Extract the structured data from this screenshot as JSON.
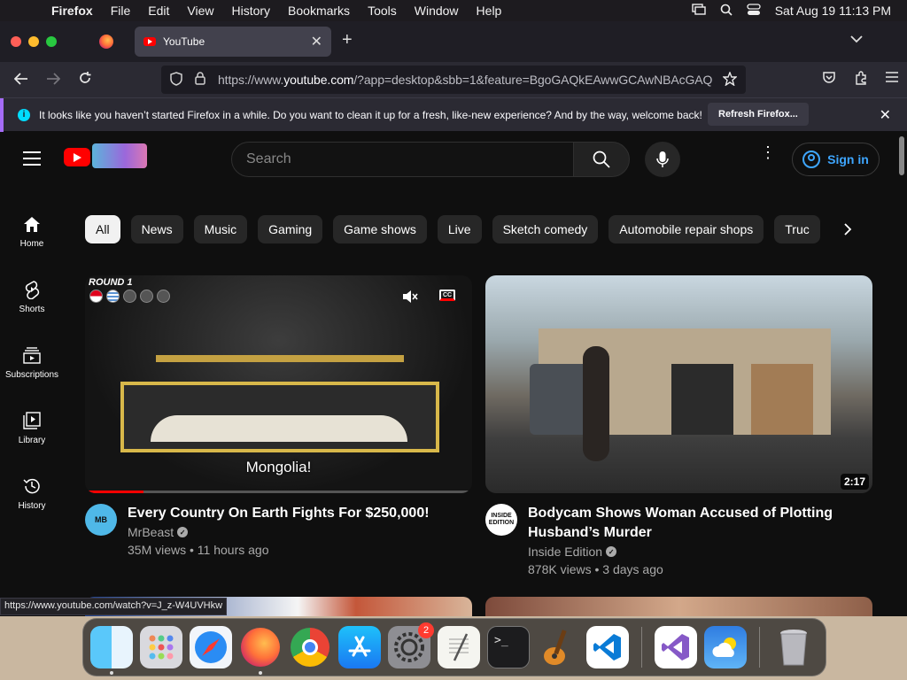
{
  "menubar": {
    "app_name": "Firefox",
    "items": [
      "File",
      "Edit",
      "View",
      "History",
      "Bookmarks",
      "Tools",
      "Window",
      "Help"
    ],
    "clock": "Sat Aug 19  11:13 PM"
  },
  "browser": {
    "tab_title": "YouTube",
    "url_prefix": "https://www.",
    "url_domain": "youtube.com",
    "url_rest": "/?app=desktop&sbb=1&feature=BgoGAQkEAwwGCAwNBAcGAQ",
    "notification_text": "It looks like you haven’t started Firefox in a while. Do you want to clean it up for a fresh, like-new experience? And by the way, welcome back!",
    "notification_button": "Refresh Firefox...",
    "status_link": "https://www.youtube.com/watch?v=J_z-W4UVHkw"
  },
  "youtube": {
    "search_placeholder": "Search",
    "sign_in": "Sign in",
    "chips": [
      "All",
      "News",
      "Music",
      "Gaming",
      "Game shows",
      "Live",
      "Sketch comedy",
      "Automobile repair shops",
      "Truc"
    ],
    "sidebar": [
      {
        "label": "Home"
      },
      {
        "label": "Shorts"
      },
      {
        "label": "Subscriptions"
      },
      {
        "label": "Library"
      },
      {
        "label": "History"
      }
    ],
    "videos": [
      {
        "title": "Every Country On Earth Fights For $250,000!",
        "channel": "MrBeast",
        "stats": "35M views • 11 hours ago",
        "overlay_round": "ROUND 1",
        "caption": "Mongolia!",
        "progress_fraction": 0.15,
        "avatar_text": "MB"
      },
      {
        "title": "Bodycam Shows Woman Accused of Plotting Husband’s Murder",
        "channel": "Inside Edition",
        "stats": "878K views • 3 days ago",
        "duration": "2:17",
        "avatar_text": "INSIDE EDITION"
      }
    ]
  },
  "dock": {
    "apps": [
      "finder",
      "launchpad",
      "safari",
      "firefox",
      "chrome",
      "app-store",
      "system-settings",
      "textedit",
      "terminal",
      "garageband",
      "vscode",
      "visual-studio",
      "weather",
      "trash"
    ],
    "settings_badge": "2"
  },
  "colors": {
    "youtube_red": "#ff0000",
    "link_blue": "#3ea6ff",
    "firefox_purple": "#a56cf7"
  }
}
